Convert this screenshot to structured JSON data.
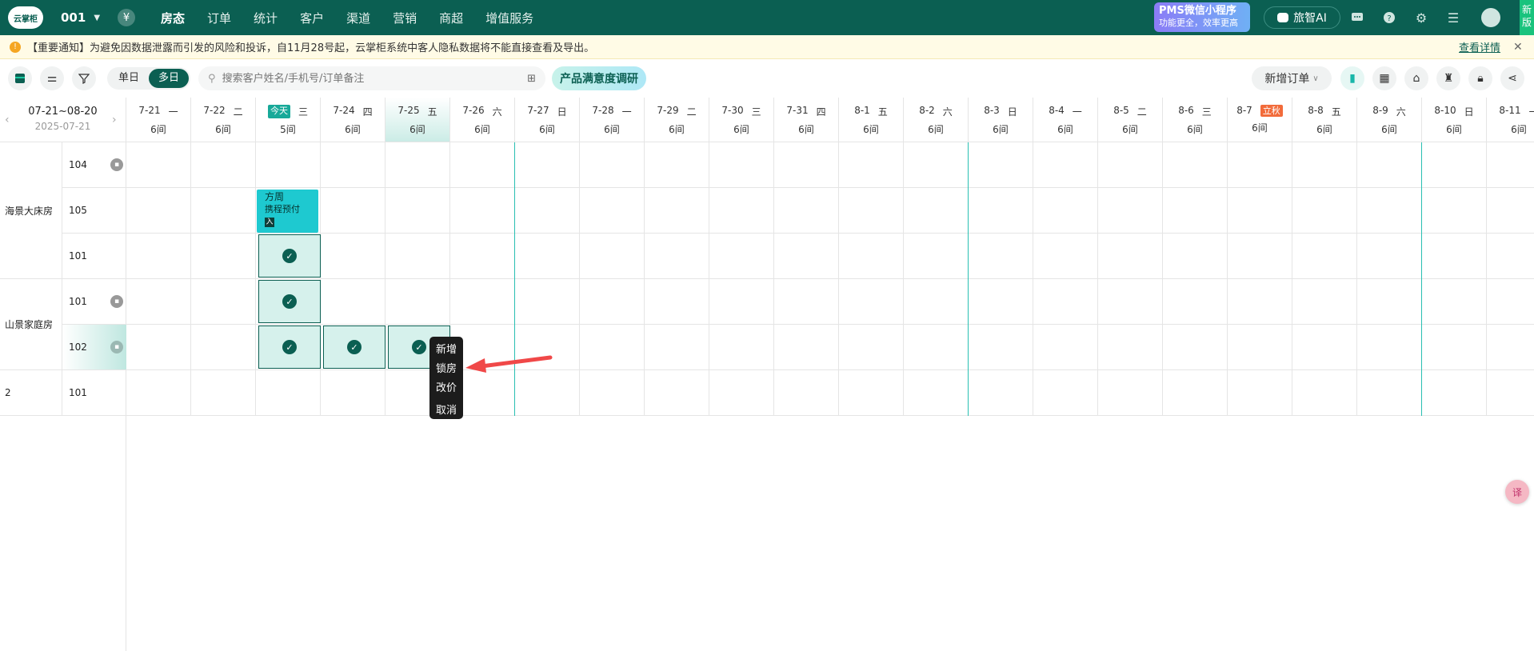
{
  "topbar": {
    "logo_text": "云掌柜",
    "store": "001",
    "nav": [
      "房态",
      "订单",
      "统计",
      "客户",
      "渠道",
      "营销",
      "商超",
      "增值服务"
    ],
    "active_nav": "房态",
    "pms_title": "PMS微信小程序",
    "pms_sub": "功能更全，效率更高",
    "ai_label": "旅智AI",
    "new_version": "新版"
  },
  "notice": {
    "message": "【重要通知】为避免因数据泄露而引发的风险和投诉，自11月28号起，云掌柜系统中客人隐私数据将不能直接查看及导出。",
    "link": "查看详情"
  },
  "toolbar": {
    "single_day": "单日",
    "multi_day": "多日",
    "search_placeholder": "搜索客户姓名/手机号/订单备注",
    "survey": "产品满意度调研",
    "new_order": "新增订单"
  },
  "range": {
    "label": "07-21~08-20",
    "date": "2025-07-21"
  },
  "dates": [
    {
      "date": "7-21",
      "weekday": "一",
      "rooms": "6间",
      "tag": ""
    },
    {
      "date": "7-22",
      "weekday": "二",
      "rooms": "6间",
      "tag": ""
    },
    {
      "date": "",
      "weekday": "三",
      "rooms": "5间",
      "tag": "今天",
      "tagType": "today"
    },
    {
      "date": "7-24",
      "weekday": "四",
      "rooms": "6间",
      "tag": ""
    },
    {
      "date": "7-25",
      "weekday": "五",
      "rooms": "6间",
      "tag": "",
      "selected": true
    },
    {
      "date": "7-26",
      "weekday": "六",
      "rooms": "6间",
      "tag": ""
    },
    {
      "date": "7-27",
      "weekday": "日",
      "rooms": "6间",
      "tag": ""
    },
    {
      "date": "7-28",
      "weekday": "一",
      "rooms": "6间",
      "tag": ""
    },
    {
      "date": "7-29",
      "weekday": "二",
      "rooms": "6间",
      "tag": ""
    },
    {
      "date": "7-30",
      "weekday": "三",
      "rooms": "6间",
      "tag": ""
    },
    {
      "date": "7-31",
      "weekday": "四",
      "rooms": "6间",
      "tag": ""
    },
    {
      "date": "8-1",
      "weekday": "五",
      "rooms": "6间",
      "tag": ""
    },
    {
      "date": "8-2",
      "weekday": "六",
      "rooms": "6间",
      "tag": ""
    },
    {
      "date": "8-3",
      "weekday": "日",
      "rooms": "6间",
      "tag": ""
    },
    {
      "date": "8-4",
      "weekday": "一",
      "rooms": "6间",
      "tag": ""
    },
    {
      "date": "8-5",
      "weekday": "二",
      "rooms": "6间",
      "tag": ""
    },
    {
      "date": "8-6",
      "weekday": "三",
      "rooms": "6间",
      "tag": ""
    },
    {
      "date": "8-7",
      "weekday": "",
      "rooms": "6间",
      "tag": "立秋",
      "tagType": "fest"
    },
    {
      "date": "8-8",
      "weekday": "五",
      "rooms": "6间",
      "tag": ""
    },
    {
      "date": "8-9",
      "weekday": "六",
      "rooms": "6间",
      "tag": ""
    },
    {
      "date": "8-10",
      "weekday": "日",
      "rooms": "6间",
      "tag": ""
    },
    {
      "date": "8-11",
      "weekday": "一",
      "rooms": "6间",
      "tag": ""
    }
  ],
  "room_types": [
    {
      "name": "海景大床房",
      "rooms": [
        {
          "no": "104",
          "locked": true
        },
        {
          "no": "105",
          "locked": false
        },
        {
          "no": "101",
          "locked": false
        }
      ]
    },
    {
      "name": "山景家庭房",
      "rooms": [
        {
          "no": "101",
          "locked": true
        },
        {
          "no": "102",
          "locked": true,
          "selected": true
        }
      ]
    },
    {
      "name": "2",
      "rooms": [
        {
          "no": "101",
          "locked": false
        }
      ]
    }
  ],
  "booking": {
    "guest": "方周",
    "channel": "携程预付",
    "source_tag": "入"
  },
  "selected_cells": [
    {
      "row": 2,
      "col": 2
    },
    {
      "row": 3,
      "col": 2
    },
    {
      "row": 4,
      "col": 2
    },
    {
      "row": 4,
      "col": 3
    },
    {
      "row": 4,
      "col": 4
    }
  ],
  "context_menu": [
    "新增",
    "锁房",
    "改价",
    "取消"
  ],
  "colors": {
    "brand": "#0b5f52",
    "accent": "#1ec9d0",
    "divider": "#29bfb2",
    "arrow": "#f04848"
  }
}
